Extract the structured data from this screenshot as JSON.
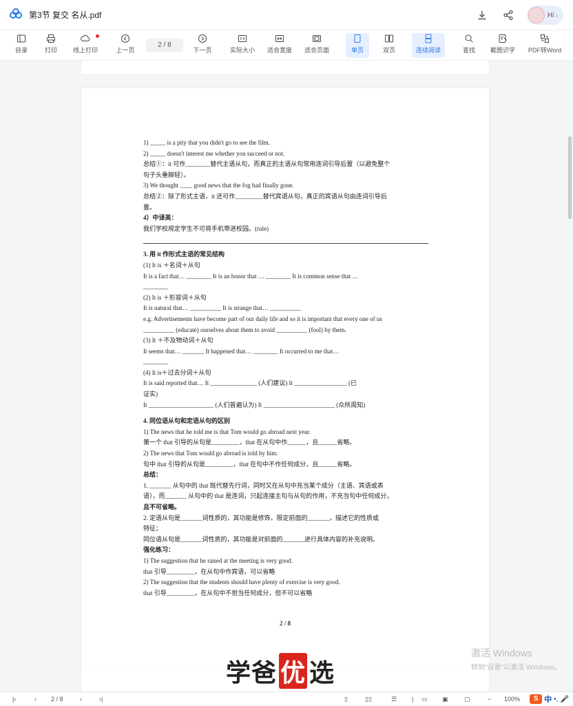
{
  "titlebar": {
    "file_name": "第3节 复交 名从.pdf",
    "user_greeting": "Hi"
  },
  "toolbar": {
    "items": [
      {
        "label": "目录",
        "icon": "sidebar-icon"
      },
      {
        "label": "打印",
        "icon": "printer-icon"
      },
      {
        "label": "线上打印",
        "icon": "cloud-print-icon"
      },
      {
        "label": "上一页",
        "icon": "arrow-left-circle-icon"
      },
      {
        "label": "下一页",
        "icon": "arrow-right-circle-icon"
      },
      {
        "label": "实际大小",
        "icon": "actual-size-icon"
      },
      {
        "label": "适合宽度",
        "icon": "fit-width-icon"
      },
      {
        "label": "适合页面",
        "icon": "fit-page-icon"
      },
      {
        "label": "单页",
        "icon": "single-page-icon"
      },
      {
        "label": "双页",
        "icon": "double-page-icon"
      },
      {
        "label": "连续阅读",
        "icon": "continuous-icon"
      },
      {
        "label": "查找",
        "icon": "search-icon"
      },
      {
        "label": "截图识字",
        "icon": "screenshot-ocr-icon"
      },
      {
        "label": "PDF转Word",
        "icon": "pdf-to-word-icon"
      }
    ],
    "page_indicator": "2 / 8"
  },
  "document": {
    "lines": [
      "1) _____ is a pity that you didn't go to see the film.",
      "2) _____ doesn't interest me whether you succeed or not.",
      "总结①：it 可作________替代主语从句，而真正的主语从句常用连词引导后置（以避免整个",
      "句子头重脚轻）。",
      "3) We thought ____ good news that the fog had finally gone.",
      "总结②：除了形式主语，it 还可作_________替代宾语从句，真正的宾语从句由连词引导后",
      "置。",
      "4）中译英：",
      "我们学校规定学生不可将手机带进校园。(rule)",
      "3. 用 it 作形式主语的常见结构",
      "(1) It is ＋名词＋从句",
      "It is a fact that… ________   It is an honor that …          ________   It is common sense that …",
      "________",
      "(2) It is ＋形容词＋从句",
      "It is natural that… __________       It is strange that… __________",
      "e.g. Advertisements have become part of our daily life and so it is important that every one of us",
      "__________ (educate) ourselves about them to avoid __________ (fool) by them.",
      "(3) It ＋不及物动词＋从句",
      "It seems that… _______       It happened that… ________       It   occurred   to   me   that…",
      "________",
      "(4) It is＋过去分词＋从句",
      "It is said  reported that…    It _______________ (人们建议)   It _________________ (已",
      "证实)",
      "It _____________________ (人们普遍认为)      It _______________________ (众所周知)",
      "4. 同位语从句和定语从句的区别",
      "1) The news that he told me is that Tom would go abroad next year.",
      "第一个 that 引导的从句是_________，that 在从句中作______，且______省略。",
      "2) The news that Tom would go abroad is told by him.",
      "句中 that 引导的从句是_________，that 在句中不作任何成分，且______省略。",
      "总结：",
      "1. _______ 从句中的 that 既代替先行词，同时又在从句中充当某个成分（主语、宾语或表",
      "语），而_______ 从句中的 that 是连词，只起连接主句与从句的作用，不充当句中任何成分，",
      "且不可省略。",
      "2. 定语从句是_______词性质的，其功能是修饰，限定前面的_______，描述它的性质或",
      "特征；",
      "同位语从句是_______词性质的，其功能是对前面的_______进行具体内容的补充说明。",
      "强化练习：",
      "1) The suggestion that he raised at the meeting is very good.",
      "that 引导_________，在从句中作宾语，可以省略",
      "2) The suggestion that the students should have plenty of exercise is very good.",
      "that 引导_________，在从句中不担当任何成分，但不可以省略"
    ],
    "page_number": "2 / 8"
  },
  "watermark": {
    "brand_prefix": "学爸",
    "brand_highlight": "优",
    "brand_suffix": "选",
    "activate_title": "激活 Windows",
    "activate_sub": "转到\"设置\"以激活 Windows。"
  },
  "statusbar": {
    "page_indicator": "2 / 8",
    "zoom": "100%",
    "ime_mode": "中"
  }
}
